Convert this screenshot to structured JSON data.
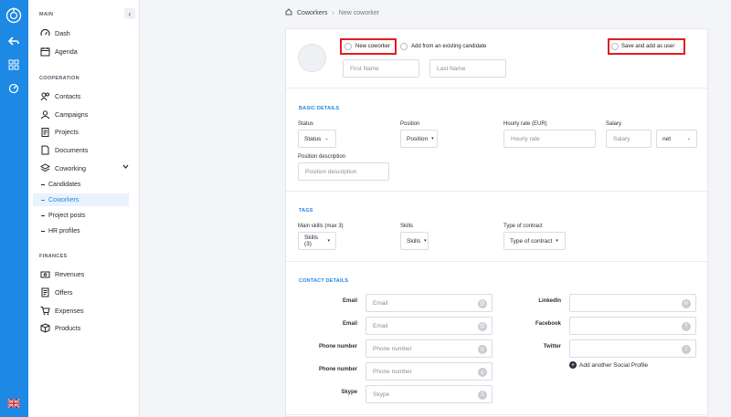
{
  "sidebar": {
    "sections": {
      "main": "MAIN",
      "cooperation": "COOPERATION",
      "finances": "FINANCES"
    },
    "items": {
      "dash": "Dash",
      "agenda": "Agenda",
      "contacts": "Contacts",
      "campaigns": "Campaigns",
      "projects": "Projects",
      "documents": "Documents",
      "coworking": "Coworking",
      "revenues": "Revenues",
      "offers": "Offers",
      "expenses": "Expenses",
      "products": "Products"
    },
    "coworking_sub": {
      "candidates": "Candidates",
      "coworkers": "Coworkers",
      "project_posts": "Project posts",
      "hr_profiles": "HR profiles"
    }
  },
  "breadcrumb": {
    "parent": "Coworkers",
    "current": "New coworker"
  },
  "header": {
    "new_coworker": "New coworker",
    "add_existing": "Add from an existing candidate",
    "save_add_user": "Save and add as user",
    "first_name_placeholder": "First Name",
    "last_name_placeholder": "Last Name"
  },
  "basic": {
    "title": "BASIC DETAILS",
    "status_label": "Status",
    "status_value": "Status",
    "position_label": "Position",
    "position_value": "Position",
    "hourly_label": "Hourly rate (EUR)",
    "hourly_placeholder": "Hourly rate",
    "salary_label": "Salary",
    "salary_placeholder": "Salary",
    "salary_type": "net",
    "posdesc_label": "Position description",
    "posdesc_placeholder": "Position description"
  },
  "tags": {
    "title": "TAGS",
    "main_skills_label": "Main skills (max 3)",
    "main_skills_value": "Skills (3)",
    "skills_label": "Skills",
    "skills_value": "Skills",
    "contract_label": "Type of contract",
    "contract_value": "Type of contract"
  },
  "contact": {
    "title": "CONTACT DETAILS",
    "email1_label": "Email",
    "email1_placeholder": "Email",
    "email2_label": "Email",
    "email2_placeholder": "Email",
    "phone1_label": "Phone number",
    "phone1_placeholder": "Phone number",
    "phone2_label": "Phone number",
    "phone2_placeholder": "Phone number",
    "skype_label": "Skype",
    "skype_placeholder": "Skype",
    "linkedin_label": "LinkedIn",
    "facebook_label": "Facebook",
    "twitter_label": "Twitter",
    "add_social": "Add another Social Profile"
  },
  "colors": {
    "accent": "#1e88e5",
    "highlight": "#e01b22"
  }
}
